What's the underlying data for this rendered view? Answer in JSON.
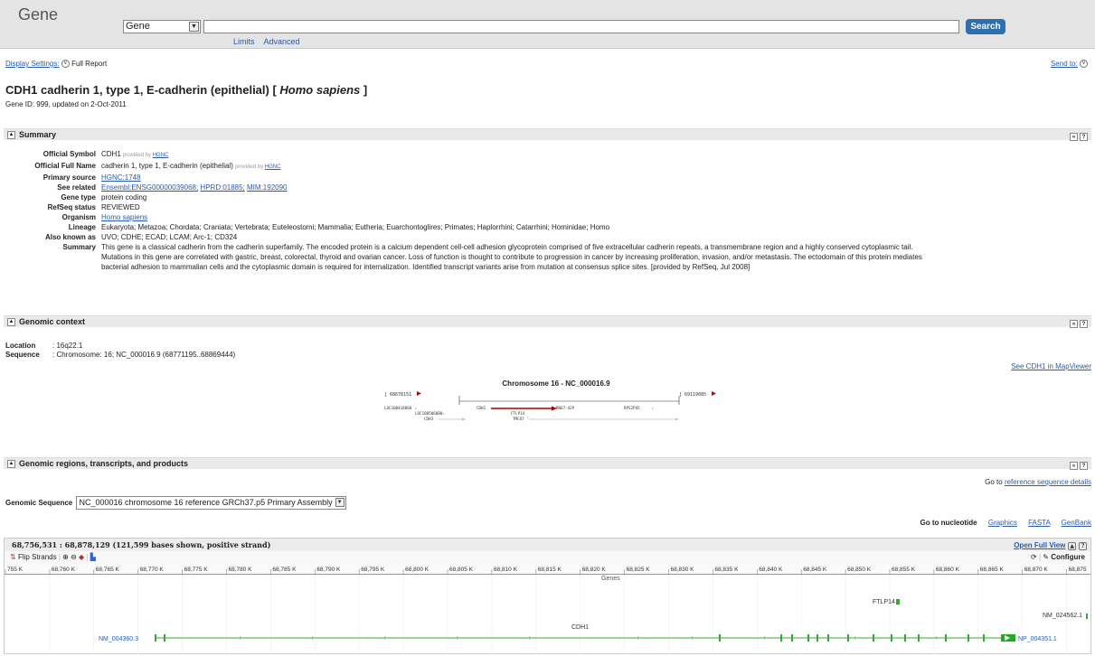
{
  "header": {
    "logo": "Gene",
    "db_selected": "Gene",
    "search_button": "Search",
    "limits": "Limits",
    "advanced": "Advanced"
  },
  "display": {
    "settings_label": "Display Settings:",
    "settings_value": "Full Report",
    "send_to": "Send to:"
  },
  "gene": {
    "title_prefix": "CDH1 cadherin 1, type 1, E-cadherin (epithelial) [ ",
    "title_species": "Homo sapiens",
    "title_suffix": " ]",
    "id_line": "Gene ID: 999, updated on 2-Oct-2011"
  },
  "summary_section": {
    "title": "Summary",
    "official_symbol": {
      "label": "Official Symbol",
      "value": "CDH1",
      "prov": "provided by ",
      "prov_link": "HGNC"
    },
    "official_full_name": {
      "label": "Official Full Name",
      "value": "cadherin 1, type 1, E-cadherin (epithelial)",
      "prov": "provided by ",
      "prov_link": "HGNC"
    },
    "primary_source": {
      "label": "Primary source",
      "value": "HGNC:1748"
    },
    "see_related": {
      "label": "See related",
      "links": [
        "Ensembl:ENSG00000039068;",
        "HPRD:01885;",
        "MIM:192090"
      ]
    },
    "gene_type": {
      "label": "Gene type",
      "value": "protein coding"
    },
    "refseq_status": {
      "label": "RefSeq status",
      "value": "REVIEWED"
    },
    "organism": {
      "label": "Organism",
      "value": "Homo sapiens"
    },
    "lineage": {
      "label": "Lineage",
      "value": "Eukaryota; Metazoa; Chordata; Craniata; Vertebrata; Euteleostomi; Mammalia; Eutheria; Euarchontoglires; Primates; Haplorrhini; Catarrhini; Hominidae; Homo"
    },
    "also_known_as": {
      "label": "Also known as",
      "value": "UVO; CDHE; ECAD; LCAM; Arc-1; CD324"
    },
    "summary": {
      "label": "Summary",
      "lines": [
        "This gene is a classical cadherin from the cadherin superfamily. The encoded protein is a calcium dependent cell-cell adhesion glycoprotein comprised of five extracellular cadherin repeats, a transmembrane region and a highly conserved cytoplasmic tail.",
        "Mutations in this gene are correlated with gastric, breast, colorectal, thyroid and ovarian cancer. Loss of function is thought to contribute to progression in cancer by increasing proliferation, invasion, and/or metastasis. The ectodomain of this protein mediates",
        "bacterial adhesion to mammalian cells and the cytoplasmic domain is required for internalization. Identified transcript variants arise from mutation at consensus splice sites. [provided by RefSeq, Jul 2008]"
      ]
    }
  },
  "genomic_context": {
    "title": "Genomic context",
    "location_label": "Location",
    "location_value": "16q22.1",
    "sequence_label": "Sequence",
    "sequence_value": "Chromosome: 16; NC_000016.9 (68771195..68869444)",
    "mapviewer": "See CDH1 in MapViewer",
    "diagram": {
      "title": "Chromosome 16 - NC_000016.9",
      "left_coord": "[ 68678151",
      "right_coord": "[ 69119085",
      "genes_row1": [
        "LOC100418868",
        "CDH1",
        "RNU7-42P",
        "RPS2P45"
      ],
      "genes_row2": [
        "LOC100506080",
        "FTLP14"
      ],
      "genes_row3": [
        "CDH3",
        "TMCO7"
      ]
    }
  },
  "genomic_regions": {
    "title": "Genomic regions, transcripts, and products",
    "goto_ref_prefix": "Go to ",
    "goto_ref_link": "reference sequence details",
    "genomic_sequence_label": "Genomic Sequence",
    "genomic_sequence_value": "NC_000016 chromosome 16 reference GRCh37.p5 Primary Assembly",
    "goto_nuc": "Go to nucleotide",
    "nuc_links": [
      "Graphics",
      "FASTA",
      "GenBank"
    ]
  },
  "viewer": {
    "range_title": "68,756,531 : 68,878,129 (121,599 bases shown, positive strand)",
    "open_full_view": "Open Full View",
    "flip_strands": "Flip Strands",
    "configure": "Configure",
    "ruler_labels": [
      "755 K",
      "68,760 K",
      "68,765 K",
      "68,770 K",
      "68,775 K",
      "68,780 K",
      "68,785 K",
      "68,790 K",
      "68,795 K",
      "68,800 K",
      "68,805 K",
      "68,810 K",
      "68,815 K",
      "68,820 K",
      "68,825 K",
      "68,830 K",
      "68,835 K",
      "68,840 K",
      "68,845 K",
      "68,850 K",
      "68,855 K",
      "68,860 K",
      "68,865 K",
      "68,870 K",
      "68,875"
    ],
    "track_title": "Genes",
    "gene_ftlp14": "FTLP14",
    "gene_nm024562": "NM_024562.1",
    "gene_cdh1": "CDH1",
    "transcript": "NM_004360.3",
    "protein": "NP_004351.1"
  }
}
